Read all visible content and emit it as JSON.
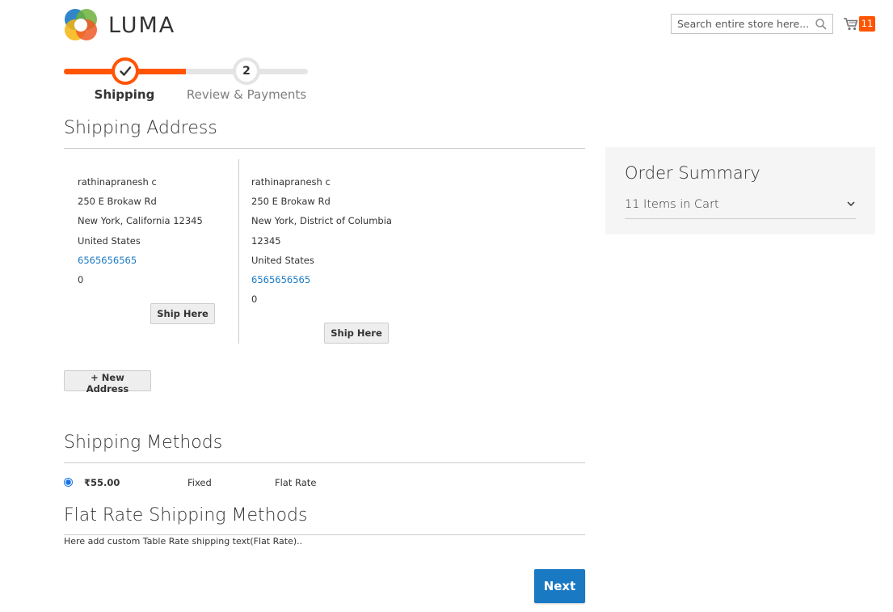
{
  "header": {
    "logo_text": "LUMA",
    "search_placeholder": "Search entire store here...",
    "cart_count": "11"
  },
  "progress": {
    "steps": [
      {
        "label": "Shipping",
        "state": "done"
      },
      {
        "label": "Review & Payments",
        "number": "2",
        "state": "pending"
      }
    ]
  },
  "shipping_address": {
    "title": "Shipping Address",
    "addresses": [
      {
        "name": "rathinapranesh c",
        "street": "250 E Brokaw Rd",
        "city_line": "New York, California 12345",
        "country": "United States",
        "phone": "6565656565",
        "extra": "0",
        "button": "Ship Here"
      },
      {
        "name": "rathinapranesh c",
        "street": "250 E Brokaw Rd",
        "city_line": "New York, District of Columbia",
        "postcode": "12345",
        "country": "United States",
        "phone": "6565656565",
        "extra": "0",
        "button": "Ship Here"
      }
    ],
    "new_address_button": "+ New Address"
  },
  "order_summary": {
    "title": "Order Summary",
    "items_in_cart": "11 Items in Cart"
  },
  "shipping_methods": {
    "title": "Shipping Methods",
    "methods": [
      {
        "price": "₹55.00",
        "method": "Fixed",
        "carrier": "Flat Rate",
        "selected": true
      }
    ]
  },
  "flat_rate": {
    "title": "Flat Rate Shipping Methods",
    "description": "Here add custom Table Rate shipping text(Flat Rate).."
  },
  "actions": {
    "next": "Next"
  },
  "colors": {
    "accent_orange": "#ff5501",
    "link_blue": "#1979c3",
    "primary_button": "#1979c3"
  }
}
